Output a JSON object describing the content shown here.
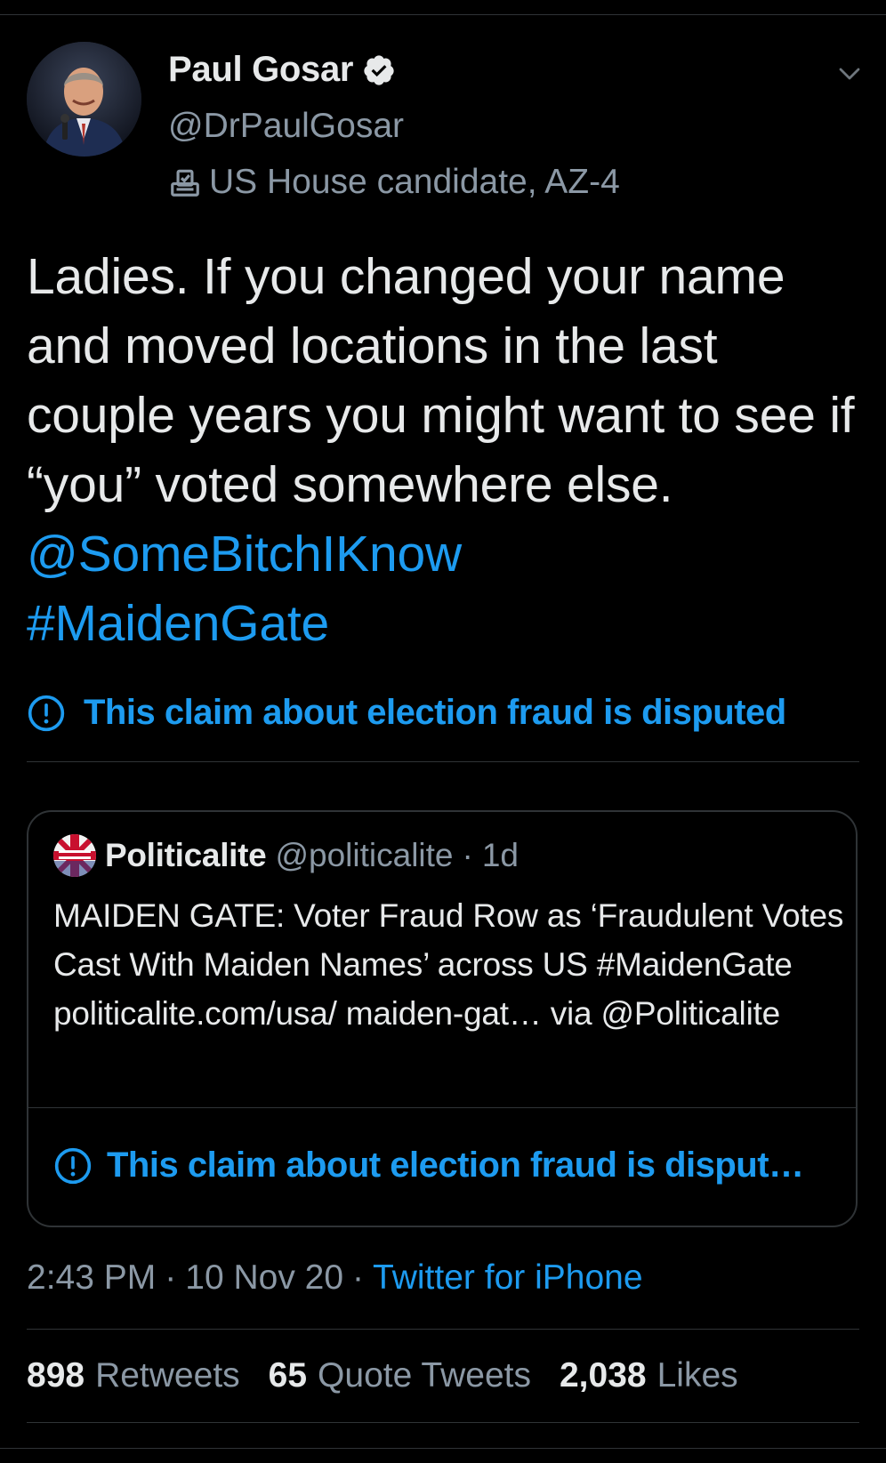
{
  "colors": {
    "background": "#000000",
    "text_primary": "#e7e9ea",
    "text_secondary": "#8b98a5",
    "accent_blue": "#1d9bf0",
    "divider": "#2f3336"
  },
  "author": {
    "display_name": "Paul Gosar",
    "handle": "@DrPaulGosar",
    "label": "US House candidate, AZ-4",
    "avatar_icon": "profile-photo",
    "verified_icon": "verified-badge-icon",
    "label_icon": "ballot-box-icon"
  },
  "tweet": {
    "text_plain": "Ladies.   If you changed your name and moved locations in the last couple years you might want to see if “you” voted somewhere else.  ",
    "mention": "@SomeBitchIKnow",
    "hashtag": "#MaidenGate",
    "warning": "This claim about election fraud is disputed"
  },
  "quoted": {
    "display_name": "Politicalite",
    "handle": "@politicalite",
    "separator": "·",
    "time": "1d",
    "text": "MAIDEN GATE: Voter Fraud Row as ‘Fraudulent Votes Cast With Maiden Names’ across US #MaidenGate   politicalite.com/usa/ maiden-gat… via @Politicalite",
    "warning": "This claim about election fraud is disput…"
  },
  "meta": {
    "time": "2:43 PM",
    "sep1": "·",
    "date": "10 Nov 20",
    "sep2": "·",
    "source": "Twitter for iPhone"
  },
  "stats": {
    "retweets_count": "898",
    "retweets_label": "Retweets",
    "quotes_count": "65",
    "quotes_label": "Quote Tweets",
    "likes_count": "2,038",
    "likes_label": "Likes"
  }
}
